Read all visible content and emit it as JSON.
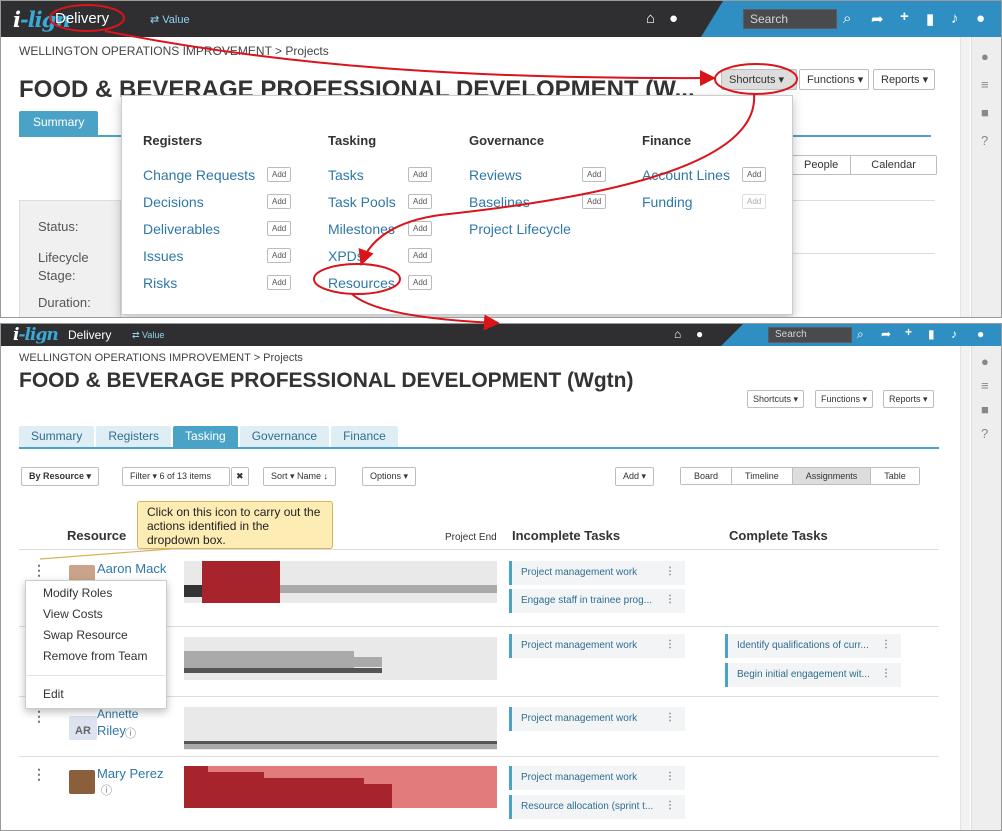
{
  "app": {
    "logo_prefix": "i",
    "logo_rest": "-lign",
    "module": "Delivery",
    "value_link": "⇄ Value",
    "search_placeholder": "Search"
  },
  "icons": [
    "home-icon",
    "globe-icon",
    "search-icon",
    "share-icon",
    "plus-icon",
    "bookmark-icon",
    "bell-icon",
    "user-icon",
    "comment-icon",
    "list-icon",
    "lock-icon",
    "help-icon"
  ],
  "accent": "#4aa3c7",
  "breadcrumb": "WELLINGTON OPERATIONS IMPROVEMENT > Projects",
  "title_truncated": "FOOD & BEVERAGE PROFESSIONAL DEVELOPMENT (W...",
  "title_full": "FOOD & BEVERAGE PROFESSIONAL DEVELOPMENT (Wgtn)",
  "header_buttons": {
    "shortcuts": "Shortcuts ▾",
    "functions": "Functions ▾",
    "reports": "Reports ▾"
  },
  "top": {
    "tab_summary": "Summary",
    "tab_people": "People",
    "tab_calendar": "Calendar",
    "status_label": "Status:",
    "lifecycle_label": "Lifecycle Stage:",
    "duration_label": "Duration:"
  },
  "shortcuts_menu": {
    "add": "Add",
    "registers": {
      "title": "Registers",
      "items": [
        "Change Requests",
        "Decisions",
        "Deliverables",
        "Issues",
        "Risks"
      ]
    },
    "tasking": {
      "title": "Tasking",
      "items": [
        "Tasks",
        "Task Pools",
        "Milestones",
        "XPDs",
        "Resources"
      ]
    },
    "governance": {
      "title": "Governance",
      "items": [
        "Reviews",
        "Baselines",
        "Project Lifecycle"
      ]
    },
    "finance": {
      "title": "Finance",
      "items": [
        "Account Lines",
        "Funding"
      ]
    }
  },
  "tabs": [
    "Summary",
    "Registers",
    "Tasking",
    "Governance",
    "Finance"
  ],
  "toolbar": {
    "group_by": "By Resource ▾",
    "filter": "Filter ▾  6 of 13 items",
    "clear": "✖",
    "sort": "Sort ▾  Name ↓",
    "options": "Options ▾",
    "add": "Add ▾",
    "views": [
      "Board",
      "Timeline",
      "Assignments",
      "Table"
    ]
  },
  "columns": {
    "resource": "Resource",
    "project_end": "Project End",
    "incomplete": "Incomplete Tasks",
    "complete": "Complete Tasks"
  },
  "callout": "Click on this icon to carry out the actions identified in the dropdown box.",
  "context_menu": [
    "Modify Roles",
    "View Costs",
    "Swap Resource",
    "Remove from Team",
    "Edit"
  ],
  "resources": [
    {
      "name": "Aaron Mack",
      "incomplete": [
        "Project management work",
        "Engage staff in trainee prog..."
      ],
      "complete": []
    },
    {
      "name": "",
      "incomplete": [
        "Project management work"
      ],
      "complete": [
        "Identify qualifications of curr...",
        "Begin initial engagement wit..."
      ]
    },
    {
      "name_first": "Annette",
      "name_last": "Riley",
      "initials": "AR",
      "incomplete": [
        "Project management work"
      ],
      "complete": []
    },
    {
      "name": "Mary Perez",
      "incomplete": [
        "Project management work",
        "Resource allocation (sprint t..."
      ],
      "complete": []
    }
  ]
}
